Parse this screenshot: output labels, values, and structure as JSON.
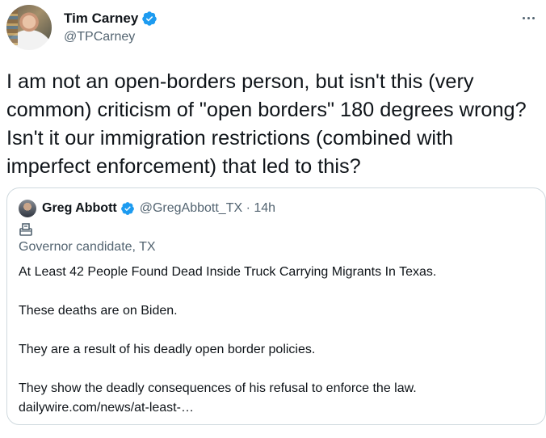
{
  "author": {
    "display_name": "Tim Carney",
    "handle": "@TPCarney"
  },
  "tweet_text": "I am not an open-borders person, but isn't this (very common) criticism of \"open borders\" 180 degrees wrong? Isn't it our immigration restrictions (combined with imperfect enforcement) that led to this?",
  "quoted": {
    "display_name": "Greg Abbott",
    "handle_time": "@GregAbbott_TX · 14h",
    "label": "Governor candidate, TX",
    "lines": [
      "At Least 42 People Found Dead Inside Truck Carrying Migrants In Texas.",
      "These deaths are on Biden.",
      "They are a result of his deadly open border policies.",
      "They show the deadly consequences of his refusal to enforce the law."
    ],
    "link": "dailywire.com/news/at-least-…"
  },
  "colors": {
    "verified_blue": "#1d9bf0",
    "secondary_text": "#536471",
    "border": "#cfd9de"
  },
  "icons": [
    "verified-badge-icon",
    "more-options-icon",
    "ballot-box-icon"
  ]
}
